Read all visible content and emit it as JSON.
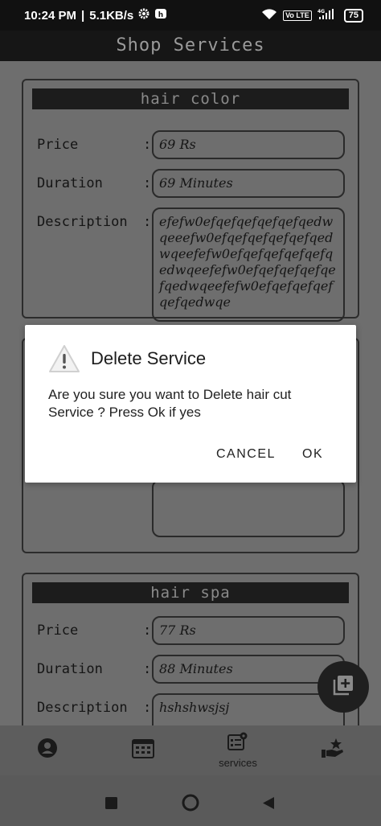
{
  "status_bar": {
    "time": "10:24 PM",
    "speed": "5.1KB/s",
    "net_badge_1": "Vo LTE",
    "net_badge_2": "4G",
    "battery": "75",
    "icons": [
      "gear-icon",
      "notification-icon",
      "wifi-icon",
      "signal-icon"
    ]
  },
  "title": "Shop Services",
  "cards": [
    {
      "name": "hair color",
      "price_label": "Price",
      "price": "69 Rs",
      "duration_label": "Duration",
      "duration": "69 Minutes",
      "description_label": "Description",
      "description": "efefw0efqefqefqefqefqedwqeeefw0efqefqefqefqefqedwqeefefw0efqefqefqefqefqedwqeefefw0efqefqefqefqefqedwqeefefw0efqefqefqefqefqedwqe"
    },
    {
      "name": "hair spa",
      "price_label": "Price",
      "price": "77 Rs",
      "duration_label": "Duration",
      "duration": "88 Minutes",
      "description_label": "Description",
      "description": "hshshwsjsj"
    }
  ],
  "colon": ":",
  "dialog": {
    "title": "Delete Service",
    "message": "Are you sure you want to Delete hair cut Service ? Press Ok if yes",
    "cancel": "CANCEL",
    "ok": "OK",
    "icon": "warning-icon"
  },
  "fab": {
    "icon": "add-box-icon"
  },
  "bottom_nav": {
    "items": [
      {
        "icon": "profile-icon",
        "label": ""
      },
      {
        "icon": "calendar-icon",
        "label": ""
      },
      {
        "icon": "services-icon",
        "label": "services"
      },
      {
        "icon": "rating-icon",
        "label": ""
      }
    ]
  },
  "system_nav": [
    "recents-icon",
    "home-icon",
    "back-icon"
  ]
}
